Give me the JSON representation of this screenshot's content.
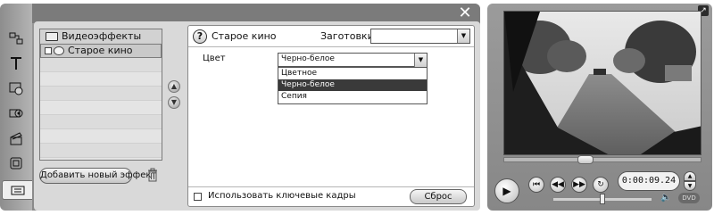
{
  "panel": {
    "close_icon": "close-icon"
  },
  "effects": {
    "category": "Видеоэффекты",
    "selected_item": "Старое кино",
    "add_button": "Добавить новый эффект"
  },
  "settings": {
    "title": "Старое кино",
    "presets_label": "Заготовки:",
    "presets_value": "",
    "color_label": "Цвет",
    "color_value": "Черно-белое",
    "color_options": [
      "Цветное",
      "Черно-белое",
      "Сепия"
    ],
    "selected_option_index": 1,
    "keyframes_label": "Использовать ключевые кадры",
    "reset_button": "Сброс"
  },
  "player": {
    "timecode": "0:00:09.24",
    "dvd_badge": "DVD"
  },
  "colors": {
    "panel_dark": "#7b7b7b",
    "selection": "#3a3a3a"
  }
}
